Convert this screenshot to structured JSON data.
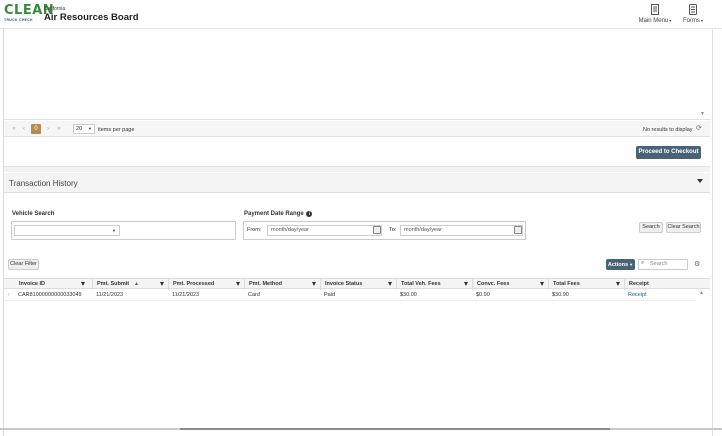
{
  "header": {
    "logo_clean": "CLEAN",
    "logo_truck": "TRUCK CHECK",
    "state": "California",
    "agency": "Air Resources Board",
    "main_menu": "Main Menu",
    "forms": "Forms"
  },
  "pager": {
    "current_page": "0",
    "page_size": "20",
    "items_per_page": "items per page",
    "no_results": "No results to display"
  },
  "checkout_button": "Proceed to Checkout",
  "transaction_history": {
    "title": "Transaction History",
    "vehicle_search_label": "Vehicle Search",
    "payment_date_label": "Payment Date Range",
    "from_label": "From:",
    "to_label": "To:",
    "date_placeholder": "month/day/year",
    "search_button": "Search",
    "clear_search_button": "Clear Search",
    "clear_filter_button": "Clear Filter",
    "actions_button": "Actions",
    "table_search_placeholder": "Search",
    "columns": [
      "Invoice ID",
      "Pmt. Submit",
      "Pmt. Processed",
      "Pmt. Method",
      "Invoice Status",
      "Total Veh. Fees",
      "Convc. Fees",
      "Total Fees",
      "Receipt"
    ],
    "rows": [
      {
        "invoice_id": "CAR81000000000033049",
        "pmt_submit": "11/21/2023",
        "pmt_processed": "11/21/2023",
        "pmt_method": "Card",
        "invoice_status": "Paid",
        "total_veh_fees": "$30.00",
        "convc_fees": "$0.90",
        "total_fees": "$30.90",
        "receipt": "Receipt"
      }
    ]
  },
  "colors": {
    "brand_green": "#3a8a3e",
    "button_dark": "#4a6374",
    "pager_active": "#b88a50",
    "link": "#1a5e8a"
  }
}
